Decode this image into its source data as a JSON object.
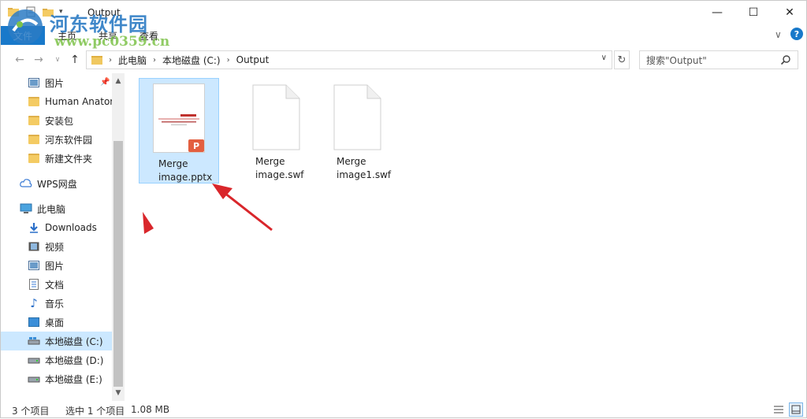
{
  "window": {
    "title": "Output",
    "minimize_glyph": "—",
    "maximize_glyph": "☐",
    "close_glyph": "✕"
  },
  "watermark": {
    "title": "河东软件园",
    "url": "www.pc0359.cn"
  },
  "ribbon": {
    "tabs": [
      "文件",
      "主页",
      "共享",
      "查看"
    ],
    "expand_glyph": "∨",
    "help_glyph": "?"
  },
  "address": {
    "crumbs": [
      "此电脑",
      "本地磁盘 (C:)",
      "Output"
    ],
    "separator": "›",
    "dropdown_glyph": "∨",
    "refresh_glyph": "↻"
  },
  "search": {
    "placeholder": "搜索\"Output\""
  },
  "sidebar": {
    "items": [
      {
        "label": "图片",
        "icon": "pictures-icon"
      },
      {
        "label": "Human Anatom",
        "icon": "folder-icon"
      },
      {
        "label": "安装包",
        "icon": "folder-icon"
      },
      {
        "label": "河东软件园",
        "icon": "folder-icon"
      },
      {
        "label": "新建文件夹",
        "icon": "folder-icon"
      },
      {
        "label": "WPS网盘",
        "icon": "cloud-icon"
      },
      {
        "label": "此电脑",
        "icon": "computer-icon"
      },
      {
        "label": "Downloads",
        "icon": "download-icon"
      },
      {
        "label": "视频",
        "icon": "video-icon"
      },
      {
        "label": "图片",
        "icon": "pictures-icon"
      },
      {
        "label": "文档",
        "icon": "document-icon"
      },
      {
        "label": "音乐",
        "icon": "music-icon"
      },
      {
        "label": "桌面",
        "icon": "desktop-icon"
      },
      {
        "label": "本地磁盘 (C:)",
        "icon": "drive-icon",
        "selected": true
      },
      {
        "label": "本地磁盘 (D:)",
        "icon": "drive-icon"
      },
      {
        "label": "本地磁盘 (E:)",
        "icon": "drive-icon"
      }
    ]
  },
  "files": [
    {
      "line1": "Merge",
      "line2": "image.pptx",
      "type": "pptx",
      "selected": true
    },
    {
      "line1": "Merge",
      "line2": "image.swf",
      "type": "swf"
    },
    {
      "line1": "Merge",
      "line2": "image1.swf",
      "type": "swf"
    }
  ],
  "status": {
    "item_count": "3 个项目",
    "selection": "选中 1 个项目",
    "size": "1.08 MB"
  },
  "colors": {
    "accent": "#1979ca",
    "selection": "#cce8ff",
    "arrow": "#d9262b",
    "pptx_badge": "#e35f40"
  }
}
